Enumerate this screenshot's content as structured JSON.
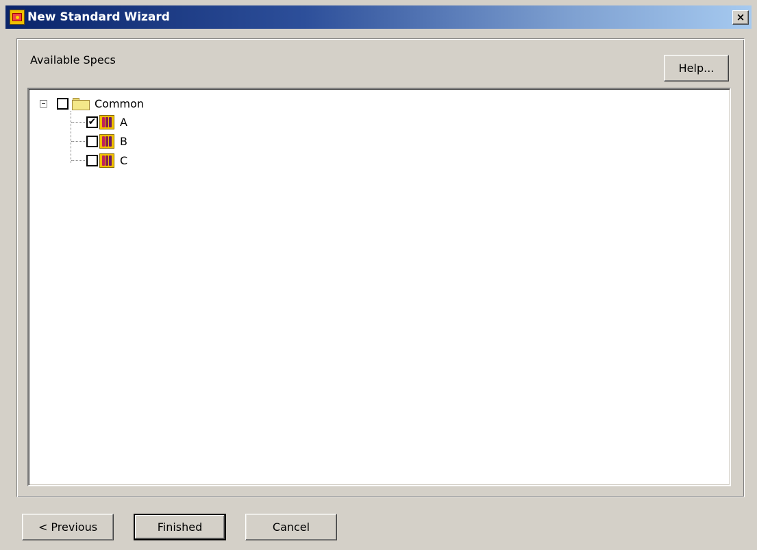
{
  "window": {
    "title": "New Standard Wizard",
    "close_label": "×"
  },
  "panel": {
    "label": "Available Specs",
    "help_label": "Help..."
  },
  "tree": {
    "root": {
      "label": "Common",
      "checked": false,
      "expanded": true,
      "icon": "folder-icon"
    },
    "children": [
      {
        "label": "A",
        "checked": true,
        "check_glyph": "✔",
        "icon": "spec-book-icon"
      },
      {
        "label": "B",
        "checked": false,
        "check_glyph": "",
        "icon": "spec-book-icon"
      },
      {
        "label": "C",
        "checked": false,
        "check_glyph": "",
        "icon": "spec-book-icon"
      }
    ]
  },
  "buttons": {
    "previous_label": "< Previous",
    "finished_label": "Finished",
    "cancel_label": "Cancel"
  },
  "colors": {
    "titlebar_start": "#0a246a",
    "titlebar_end": "#a6caf0",
    "window_bg": "#d4d0c8",
    "tree_bg": "#ffffff"
  }
}
